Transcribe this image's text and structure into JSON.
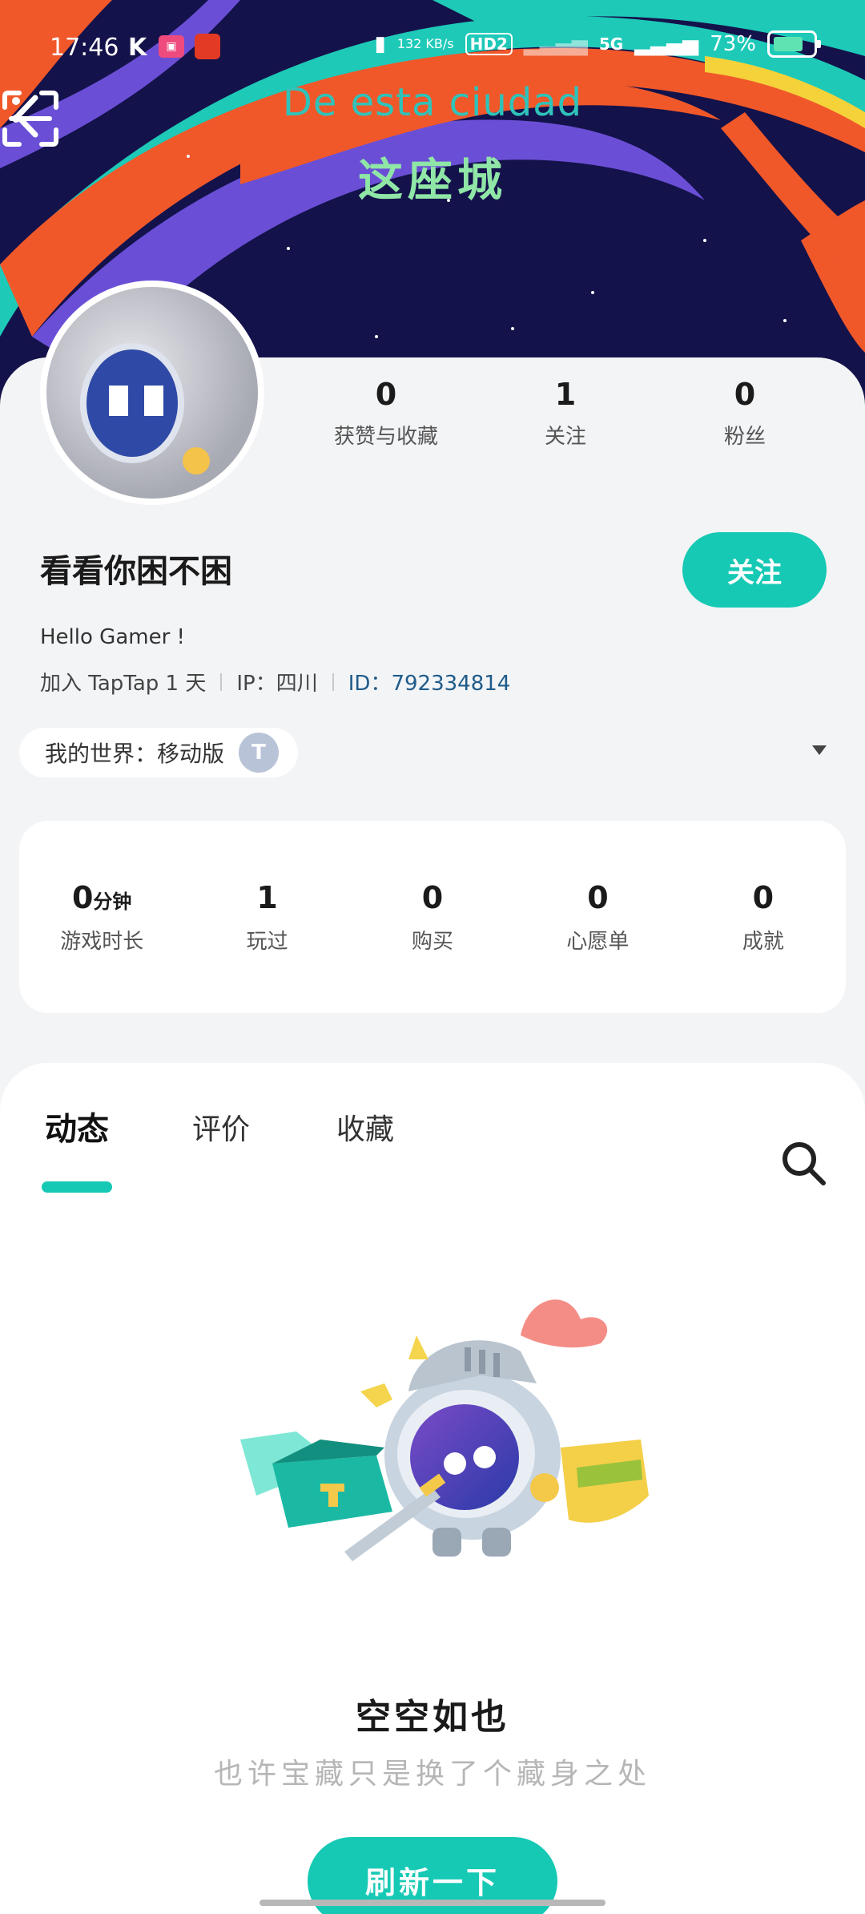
{
  "status_bar": {
    "time": "17:46",
    "k_label": "K",
    "network_speed": "132 KB/s",
    "hd_label": "HD2",
    "network_type": "5G",
    "battery": "73%"
  },
  "header": {
    "title_es": "De esta ciudad",
    "title_cn": "这座城",
    "back_icon": "back-arrow-icon",
    "scan_icon": "scan-icon",
    "more_icon": "more-vertical-icon"
  },
  "profile": {
    "username": "看看你困不困",
    "follow_label": "关注",
    "bio": "Hello Gamer !",
    "join_text": "加入 TapTap 1 天",
    "ip_text": "IP：四川",
    "id_label": "ID：",
    "id_value": "792334814",
    "stats": [
      {
        "value": "0",
        "label": "获赞与收藏"
      },
      {
        "value": "1",
        "label": "关注"
      },
      {
        "value": "0",
        "label": "粉丝"
      }
    ]
  },
  "world_chip": {
    "label": "我的世界：移动版",
    "badge": "T"
  },
  "game_stats": [
    {
      "value": "0",
      "unit": "分钟",
      "label": "游戏时长"
    },
    {
      "value": "1",
      "unit": "",
      "label": "玩过"
    },
    {
      "value": "0",
      "unit": "",
      "label": "购买"
    },
    {
      "value": "0",
      "unit": "",
      "label": "心愿单"
    },
    {
      "value": "0",
      "unit": "",
      "label": "成就"
    }
  ],
  "tabs": [
    {
      "label": "动态",
      "active": true
    },
    {
      "label": "评价",
      "active": false
    },
    {
      "label": "收藏",
      "active": false
    }
  ],
  "empty_state": {
    "title": "空空如也",
    "subtitle": "也许宝藏只是换了个藏身之处",
    "button": "刷新一下"
  },
  "colors": {
    "accent": "#16c9b4",
    "banner_bg": "#14124a",
    "banner_orange": "#f0582a",
    "banner_purple": "#6a4fd6",
    "banner_teal": "#1ec9b8"
  }
}
